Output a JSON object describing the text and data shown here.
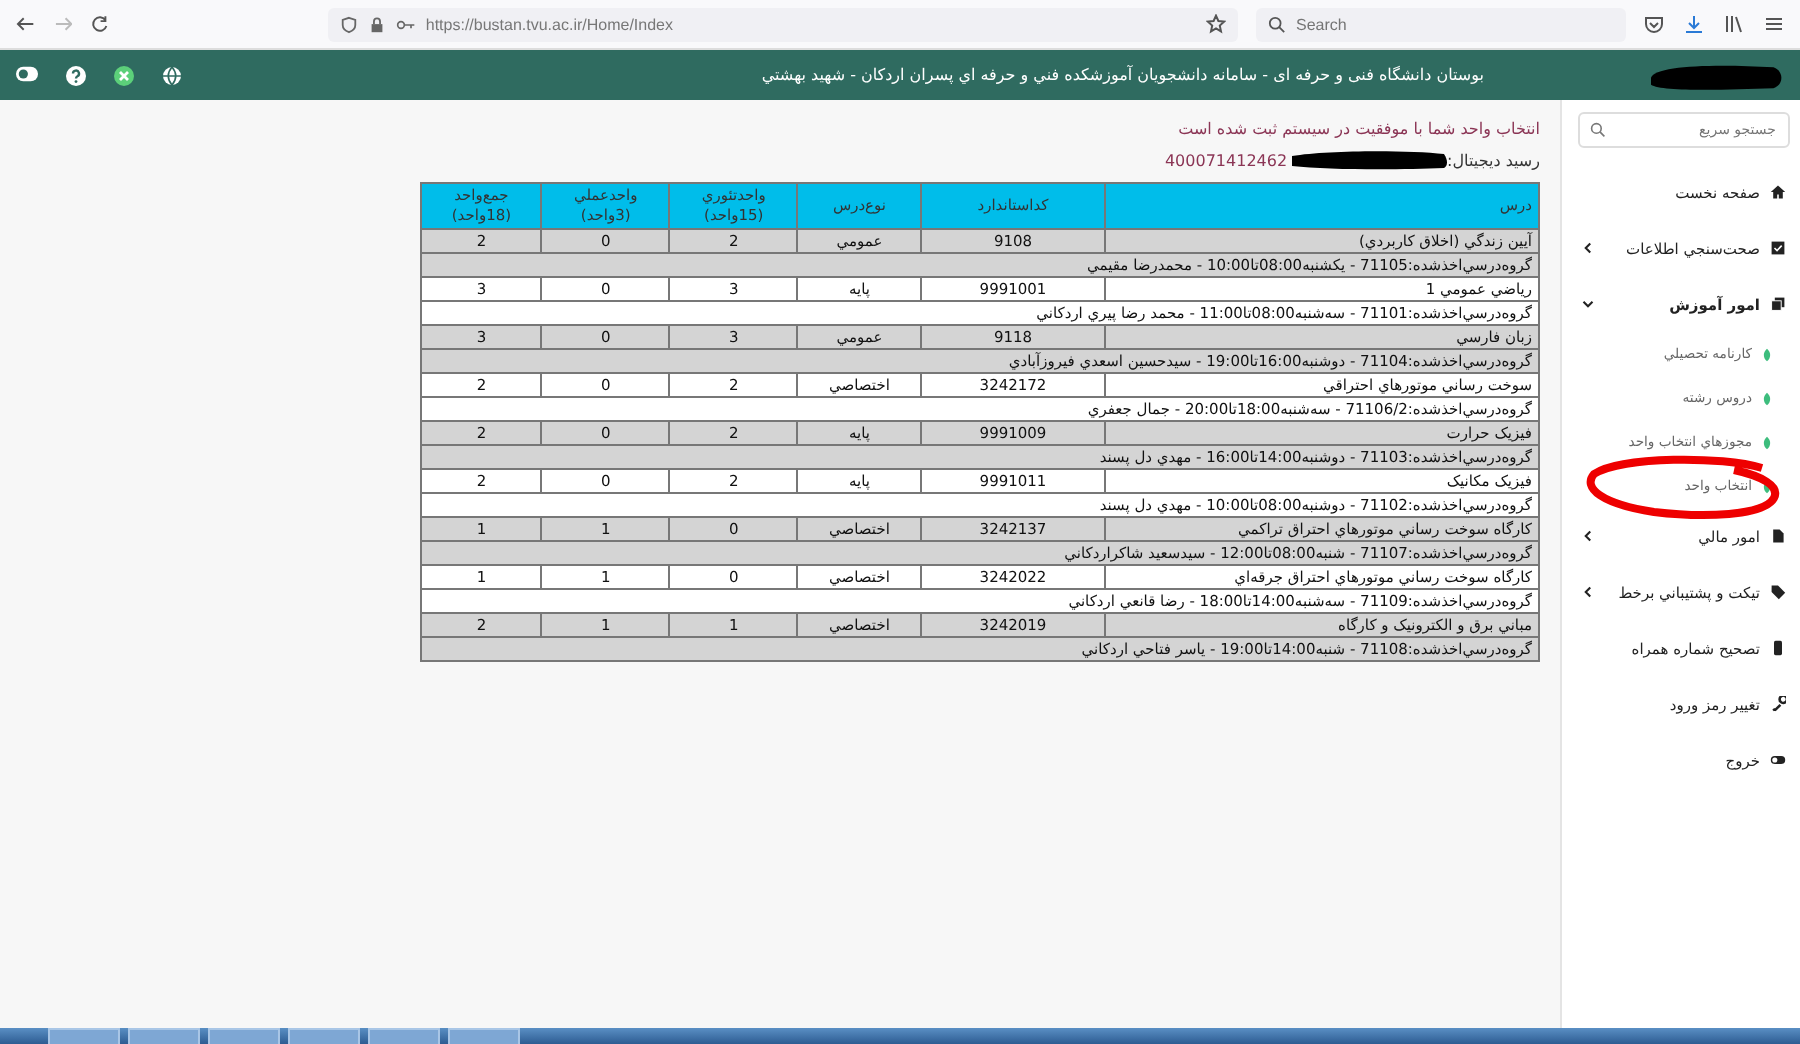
{
  "browser": {
    "url": "https://bustan.tvu.ac.ir/Home/Index",
    "search_placeholder": "Search"
  },
  "header": {
    "title": "بوستان دانشگاه فنی و حرفه ای - سامانه دانشجويان آموزشکده فني و حرفه اي پسران اردکان - شهيد بهشتي"
  },
  "message": "انتخاب واحد شما با موفقيت در سيستم ثبت شده است",
  "receipt": {
    "label": "رسيد ديجيتال:",
    "value": "400071412462"
  },
  "table": {
    "columns": [
      {
        "label": "درس"
      },
      {
        "label": "کداستاندارد"
      },
      {
        "label": "نوع‌درس"
      },
      {
        "label": "واحدتئوري",
        "sub": "(15واحد)"
      },
      {
        "label": "واحدعملي",
        "sub": "(3واحد)"
      },
      {
        "label": "جمع‌واحد",
        "sub": "(18واحد)"
      }
    ],
    "rows": [
      {
        "course": "آيين زندگي (اخلاق کاربردي)",
        "code": "9108",
        "type": "عمومي",
        "theory": "2",
        "practical": "0",
        "total": "2",
        "group": "گروه‌درسي‌اخذشده:71105 - يکشنبه08:00تا10:00 - محمدرضا مقيمي"
      },
      {
        "course": "رياضي عمومي 1",
        "code": "9991001",
        "type": "پايه",
        "theory": "3",
        "practical": "0",
        "total": "3",
        "group": "گروه‌درسي‌اخذشده:71101 - سه‌شنبه08:00تا11:00 - محمد رضا پيري اردکاني"
      },
      {
        "course": "زبان فارسي",
        "code": "9118",
        "type": "عمومي",
        "theory": "3",
        "practical": "0",
        "total": "3",
        "group": "گروه‌درسي‌اخذشده:71104 - دوشنبه16:00تا19:00 - سيدحسين اسعدي فيروزآبادي"
      },
      {
        "course": "سوخت رساني موتورهاي احتراقي",
        "code": "3242172",
        "type": "اختصاصي",
        "theory": "2",
        "practical": "0",
        "total": "2",
        "group": "گروه‌درسي‌اخذشده:71106/2 - سه‌شنبه18:00تا20:00 - جمال جعفري"
      },
      {
        "course": "فيزيک حرارت",
        "code": "9991009",
        "type": "پايه",
        "theory": "2",
        "practical": "0",
        "total": "2",
        "group": "گروه‌درسي‌اخذشده:71103 - دوشنبه14:00تا16:00 - مهدي دل پسند"
      },
      {
        "course": "فيزيک مکانيک",
        "code": "9991011",
        "type": "پايه",
        "theory": "2",
        "practical": "0",
        "total": "2",
        "group": "گروه‌درسي‌اخذشده:71102 - دوشنبه08:00تا10:00 - مهدي دل پسند"
      },
      {
        "course": "کارگاه سوخت رساني موتورهاي احتراق تراکمي",
        "code": "3242137",
        "type": "اختصاصي",
        "theory": "0",
        "practical": "1",
        "total": "1",
        "group": "گروه‌درسي‌اخذشده:71107 - شنبه08:00تا12:00 - سيدسعيد شاکراردکاني"
      },
      {
        "course": "کارگاه سوخت رساني موتورهاي احتراق جرقه‌اي",
        "code": "3242022",
        "type": "اختصاصي",
        "theory": "0",
        "practical": "1",
        "total": "1",
        "group": "گروه‌درسي‌اخذشده:71109 - سه‌شنبه14:00تا18:00 - رضا قانعي اردکاني"
      },
      {
        "course": "مباني برق و الکترونيک و کارگاه",
        "code": "3242019",
        "type": "اختصاصي",
        "theory": "1",
        "practical": "1",
        "total": "2",
        "group": "گروه‌درسي‌اخذشده:71108 - شنبه14:00تا19:00 - ياسر فتاحي اردکاني"
      }
    ]
  },
  "sidebar": {
    "search_placeholder": "جستجو سريع",
    "items": [
      {
        "label": "صفحه نخست"
      },
      {
        "label": "صحت‌سنجي اطلاعات",
        "expanded": false
      },
      {
        "label": "امور آموزش",
        "expanded": true,
        "children": [
          {
            "label": "کارنامه تحصيلي"
          },
          {
            "label": "دروس رشته"
          },
          {
            "label": "مجوزهاي انتخاب واحد"
          },
          {
            "label": "انتخاب واحد"
          }
        ]
      },
      {
        "label": "امور مالي",
        "expanded": false
      },
      {
        "label": "تيکت و پشتيباني برخط",
        "expanded": false
      },
      {
        "label": "تصحيح شماره همراه"
      },
      {
        "label": "تغيير رمز ورود"
      },
      {
        "label": "خروج"
      }
    ]
  }
}
